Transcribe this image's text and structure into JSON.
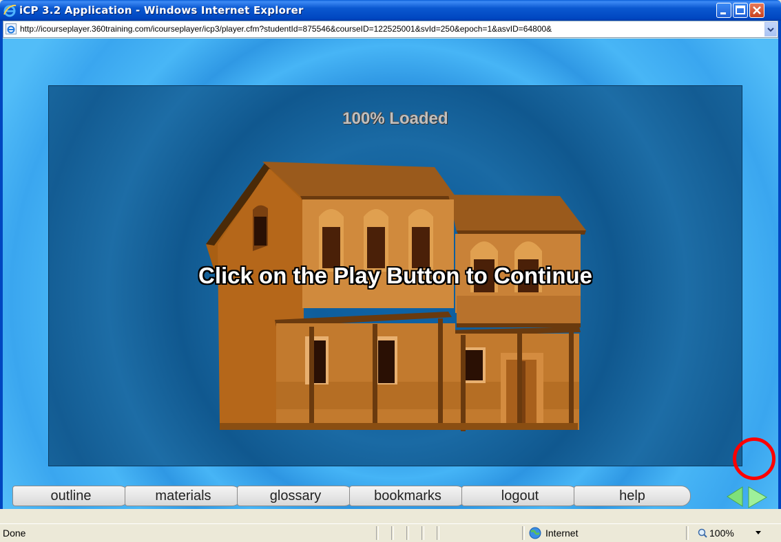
{
  "window": {
    "title": "iCP 3.2 Application - Windows Internet Explorer",
    "icon": "ie-icon",
    "controls": [
      "minimize-icon",
      "maximize-icon",
      "close-icon"
    ]
  },
  "address": {
    "url": "http://icourseplayer.360training.com/icourseplayer/icp3/player.cfm?studentId=875546&courseID=122525001&svId=250&epoch=1&asvID=64800&"
  },
  "player": {
    "loading_text": "100% Loaded",
    "prompt": "Click on the Play Button to Continue"
  },
  "nav": {
    "tabs": [
      "outline",
      "materials",
      "glossary",
      "bookmarks",
      "logout",
      "help"
    ],
    "prev_icon": "back-arrow-icon",
    "next_icon": "play-arrow-icon"
  },
  "status": {
    "text": "Done",
    "zone": "Internet",
    "zoom": "100%"
  },
  "colors": {
    "title_bar": "#0a58d0",
    "stage_bg": "#10588f",
    "arrow_green": "#7ee07a",
    "highlight_circle": "#ff0000"
  }
}
